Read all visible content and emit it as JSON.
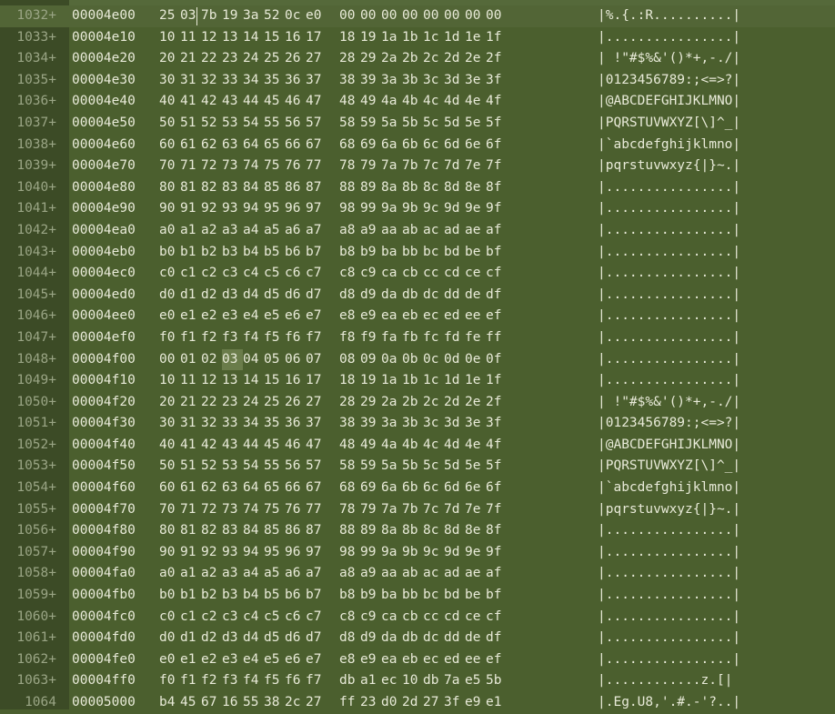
{
  "rows": [
    {
      "ln": "1032+",
      "addr": "00004e00",
      "hex": [
        "25",
        "03",
        "7b",
        "19",
        "3a",
        "52",
        "0c",
        "e0",
        "00",
        "00",
        "00",
        "00",
        "00",
        "00",
        "00",
        "00"
      ],
      "ascii": "|%.{.:R..........|"
    },
    {
      "ln": "1033+",
      "addr": "00004e10",
      "hex": [
        "10",
        "11",
        "12",
        "13",
        "14",
        "15",
        "16",
        "17",
        "18",
        "19",
        "1a",
        "1b",
        "1c",
        "1d",
        "1e",
        "1f"
      ],
      "ascii": "|................|"
    },
    {
      "ln": "1034+",
      "addr": "00004e20",
      "hex": [
        "20",
        "21",
        "22",
        "23",
        "24",
        "25",
        "26",
        "27",
        "28",
        "29",
        "2a",
        "2b",
        "2c",
        "2d",
        "2e",
        "2f"
      ],
      "ascii": "| !\"#$%&'()*+,-./|"
    },
    {
      "ln": "1035+",
      "addr": "00004e30",
      "hex": [
        "30",
        "31",
        "32",
        "33",
        "34",
        "35",
        "36",
        "37",
        "38",
        "39",
        "3a",
        "3b",
        "3c",
        "3d",
        "3e",
        "3f"
      ],
      "ascii": "|0123456789:;<=>?|"
    },
    {
      "ln": "1036+",
      "addr": "00004e40",
      "hex": [
        "40",
        "41",
        "42",
        "43",
        "44",
        "45",
        "46",
        "47",
        "48",
        "49",
        "4a",
        "4b",
        "4c",
        "4d",
        "4e",
        "4f"
      ],
      "ascii": "|@ABCDEFGHIJKLMNO|"
    },
    {
      "ln": "1037+",
      "addr": "00004e50",
      "hex": [
        "50",
        "51",
        "52",
        "53",
        "54",
        "55",
        "56",
        "57",
        "58",
        "59",
        "5a",
        "5b",
        "5c",
        "5d",
        "5e",
        "5f"
      ],
      "ascii": "|PQRSTUVWXYZ[\\]^_|"
    },
    {
      "ln": "1038+",
      "addr": "00004e60",
      "hex": [
        "60",
        "61",
        "62",
        "63",
        "64",
        "65",
        "66",
        "67",
        "68",
        "69",
        "6a",
        "6b",
        "6c",
        "6d",
        "6e",
        "6f"
      ],
      "ascii": "|`abcdefghijklmno|"
    },
    {
      "ln": "1039+",
      "addr": "00004e70",
      "hex": [
        "70",
        "71",
        "72",
        "73",
        "74",
        "75",
        "76",
        "77",
        "78",
        "79",
        "7a",
        "7b",
        "7c",
        "7d",
        "7e",
        "7f"
      ],
      "ascii": "|pqrstuvwxyz{|}~.|"
    },
    {
      "ln": "1040+",
      "addr": "00004e80",
      "hex": [
        "80",
        "81",
        "82",
        "83",
        "84",
        "85",
        "86",
        "87",
        "88",
        "89",
        "8a",
        "8b",
        "8c",
        "8d",
        "8e",
        "8f"
      ],
      "ascii": "|................|"
    },
    {
      "ln": "1041+",
      "addr": "00004e90",
      "hex": [
        "90",
        "91",
        "92",
        "93",
        "94",
        "95",
        "96",
        "97",
        "98",
        "99",
        "9a",
        "9b",
        "9c",
        "9d",
        "9e",
        "9f"
      ],
      "ascii": "|................|"
    },
    {
      "ln": "1042+",
      "addr": "00004ea0",
      "hex": [
        "a0",
        "a1",
        "a2",
        "a3",
        "a4",
        "a5",
        "a6",
        "a7",
        "a8",
        "a9",
        "aa",
        "ab",
        "ac",
        "ad",
        "ae",
        "af"
      ],
      "ascii": "|................|"
    },
    {
      "ln": "1043+",
      "addr": "00004eb0",
      "hex": [
        "b0",
        "b1",
        "b2",
        "b3",
        "b4",
        "b5",
        "b6",
        "b7",
        "b8",
        "b9",
        "ba",
        "bb",
        "bc",
        "bd",
        "be",
        "bf"
      ],
      "ascii": "|................|"
    },
    {
      "ln": "1044+",
      "addr": "00004ec0",
      "hex": [
        "c0",
        "c1",
        "c2",
        "c3",
        "c4",
        "c5",
        "c6",
        "c7",
        "c8",
        "c9",
        "ca",
        "cb",
        "cc",
        "cd",
        "ce",
        "cf"
      ],
      "ascii": "|................|"
    },
    {
      "ln": "1045+",
      "addr": "00004ed0",
      "hex": [
        "d0",
        "d1",
        "d2",
        "d3",
        "d4",
        "d5",
        "d6",
        "d7",
        "d8",
        "d9",
        "da",
        "db",
        "dc",
        "dd",
        "de",
        "df"
      ],
      "ascii": "|................|"
    },
    {
      "ln": "1046+",
      "addr": "00004ee0",
      "hex": [
        "e0",
        "e1",
        "e2",
        "e3",
        "e4",
        "e5",
        "e6",
        "e7",
        "e8",
        "e9",
        "ea",
        "eb",
        "ec",
        "ed",
        "ee",
        "ef"
      ],
      "ascii": "|................|"
    },
    {
      "ln": "1047+",
      "addr": "00004ef0",
      "hex": [
        "f0",
        "f1",
        "f2",
        "f3",
        "f4",
        "f5",
        "f6",
        "f7",
        "f8",
        "f9",
        "fa",
        "fb",
        "fc",
        "fd",
        "fe",
        "ff"
      ],
      "ascii": "|................|"
    },
    {
      "ln": "1048+",
      "addr": "00004f00",
      "hex": [
        "00",
        "01",
        "02",
        "03",
        "04",
        "05",
        "06",
        "07",
        "08",
        "09",
        "0a",
        "0b",
        "0c",
        "0d",
        "0e",
        "0f"
      ],
      "ascii": "|................|"
    },
    {
      "ln": "1049+",
      "addr": "00004f10",
      "hex": [
        "10",
        "11",
        "12",
        "13",
        "14",
        "15",
        "16",
        "17",
        "18",
        "19",
        "1a",
        "1b",
        "1c",
        "1d",
        "1e",
        "1f"
      ],
      "ascii": "|................|"
    },
    {
      "ln": "1050+",
      "addr": "00004f20",
      "hex": [
        "20",
        "21",
        "22",
        "23",
        "24",
        "25",
        "26",
        "27",
        "28",
        "29",
        "2a",
        "2b",
        "2c",
        "2d",
        "2e",
        "2f"
      ],
      "ascii": "| !\"#$%&'()*+,-./|"
    },
    {
      "ln": "1051+",
      "addr": "00004f30",
      "hex": [
        "30",
        "31",
        "32",
        "33",
        "34",
        "35",
        "36",
        "37",
        "38",
        "39",
        "3a",
        "3b",
        "3c",
        "3d",
        "3e",
        "3f"
      ],
      "ascii": "|0123456789:;<=>?|"
    },
    {
      "ln": "1052+",
      "addr": "00004f40",
      "hex": [
        "40",
        "41",
        "42",
        "43",
        "44",
        "45",
        "46",
        "47",
        "48",
        "49",
        "4a",
        "4b",
        "4c",
        "4d",
        "4e",
        "4f"
      ],
      "ascii": "|@ABCDEFGHIJKLMNO|"
    },
    {
      "ln": "1053+",
      "addr": "00004f50",
      "hex": [
        "50",
        "51",
        "52",
        "53",
        "54",
        "55",
        "56",
        "57",
        "58",
        "59",
        "5a",
        "5b",
        "5c",
        "5d",
        "5e",
        "5f"
      ],
      "ascii": "|PQRSTUVWXYZ[\\]^_|"
    },
    {
      "ln": "1054+",
      "addr": "00004f60",
      "hex": [
        "60",
        "61",
        "62",
        "63",
        "64",
        "65",
        "66",
        "67",
        "68",
        "69",
        "6a",
        "6b",
        "6c",
        "6d",
        "6e",
        "6f"
      ],
      "ascii": "|`abcdefghijklmno|"
    },
    {
      "ln": "1055+",
      "addr": "00004f70",
      "hex": [
        "70",
        "71",
        "72",
        "73",
        "74",
        "75",
        "76",
        "77",
        "78",
        "79",
        "7a",
        "7b",
        "7c",
        "7d",
        "7e",
        "7f"
      ],
      "ascii": "|pqrstuvwxyz{|}~.|"
    },
    {
      "ln": "1056+",
      "addr": "00004f80",
      "hex": [
        "80",
        "81",
        "82",
        "83",
        "84",
        "85",
        "86",
        "87",
        "88",
        "89",
        "8a",
        "8b",
        "8c",
        "8d",
        "8e",
        "8f"
      ],
      "ascii": "|................|"
    },
    {
      "ln": "1057+",
      "addr": "00004f90",
      "hex": [
        "90",
        "91",
        "92",
        "93",
        "94",
        "95",
        "96",
        "97",
        "98",
        "99",
        "9a",
        "9b",
        "9c",
        "9d",
        "9e",
        "9f"
      ],
      "ascii": "|................|"
    },
    {
      "ln": "1058+",
      "addr": "00004fa0",
      "hex": [
        "a0",
        "a1",
        "a2",
        "a3",
        "a4",
        "a5",
        "a6",
        "a7",
        "a8",
        "a9",
        "aa",
        "ab",
        "ac",
        "ad",
        "ae",
        "af"
      ],
      "ascii": "|................|"
    },
    {
      "ln": "1059+",
      "addr": "00004fb0",
      "hex": [
        "b0",
        "b1",
        "b2",
        "b3",
        "b4",
        "b5",
        "b6",
        "b7",
        "b8",
        "b9",
        "ba",
        "bb",
        "bc",
        "bd",
        "be",
        "bf"
      ],
      "ascii": "|................|"
    },
    {
      "ln": "1060+",
      "addr": "00004fc0",
      "hex": [
        "c0",
        "c1",
        "c2",
        "c3",
        "c4",
        "c5",
        "c6",
        "c7",
        "c8",
        "c9",
        "ca",
        "cb",
        "cc",
        "cd",
        "ce",
        "cf"
      ],
      "ascii": "|................|"
    },
    {
      "ln": "1061+",
      "addr": "00004fd0",
      "hex": [
        "d0",
        "d1",
        "d2",
        "d3",
        "d4",
        "d5",
        "d6",
        "d7",
        "d8",
        "d9",
        "da",
        "db",
        "dc",
        "dd",
        "de",
        "df"
      ],
      "ascii": "|................|"
    },
    {
      "ln": "1062+",
      "addr": "00004fe0",
      "hex": [
        "e0",
        "e1",
        "e2",
        "e3",
        "e4",
        "e5",
        "e6",
        "e7",
        "e8",
        "e9",
        "ea",
        "eb",
        "ec",
        "ed",
        "ee",
        "ef"
      ],
      "ascii": "|................|"
    },
    {
      "ln": "1063+",
      "addr": "00004ff0",
      "hex": [
        "f0",
        "f1",
        "f2",
        "f3",
        "f4",
        "f5",
        "f6",
        "f7",
        "db",
        "a1",
        "ec",
        "10",
        "db",
        "7a",
        "e5",
        "5b"
      ],
      "ascii": "|............z.[|"
    },
    {
      "ln": "1064",
      "addr": "00005000",
      "hex": [
        "b4",
        "45",
        "67",
        "16",
        "55",
        "38",
        "2c",
        "27",
        "ff",
        "23",
        "d0",
        "2d",
        "27",
        "3f",
        "e9",
        "e1"
      ],
      "ascii": "|.Eg.U8,'.#.-'?..|"
    }
  ],
  "highlight": {
    "row": 16,
    "byte": 3
  },
  "cursor": {
    "row": 0,
    "byte": 1
  },
  "colors": {
    "background": "#4b5f2e",
    "gutter": "#3c4b26",
    "text": "#e8ead8",
    "line_number": "#9aa585",
    "byte_highlight": "#6a7c4a"
  }
}
